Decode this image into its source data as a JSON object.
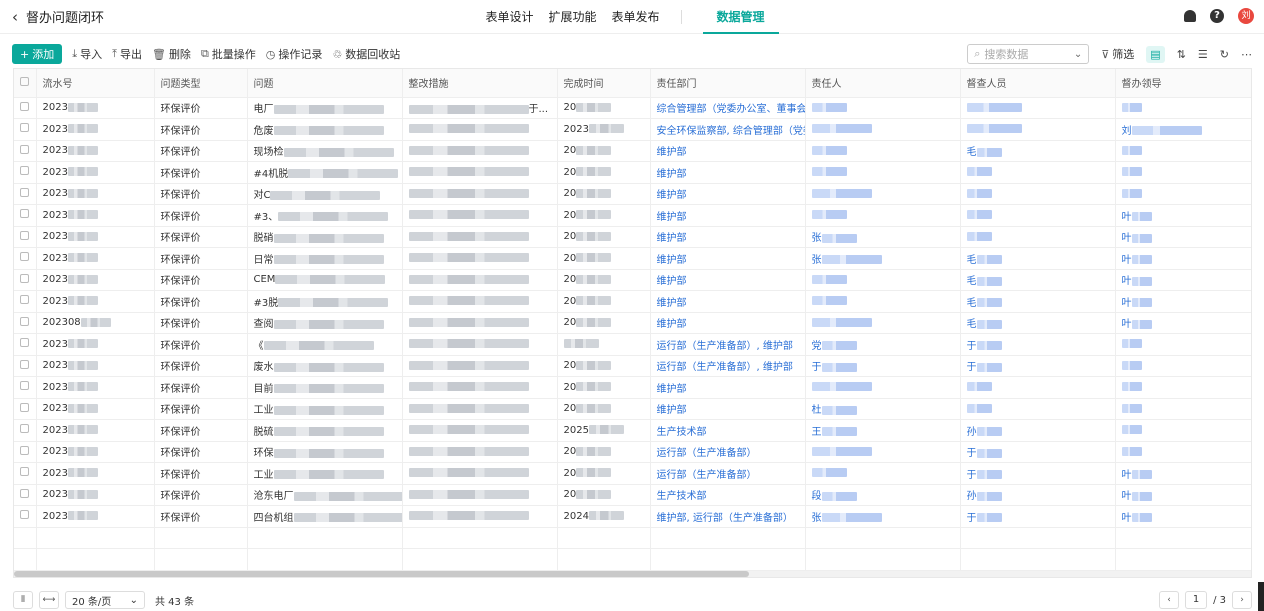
{
  "header": {
    "title": "督办问题闭环",
    "tabs": [
      "表单设计",
      "扩展功能",
      "表单发布",
      "数据管理"
    ],
    "active_tab": "数据管理",
    "help": "?",
    "avatar": "刘"
  },
  "toolbar": {
    "add": "添加",
    "import": "导入",
    "export": "导出",
    "delete": "删除",
    "batch": "批量操作",
    "log": "操作记录",
    "recycle": "数据回收站",
    "search_placeholder": "搜索数据",
    "filter": "筛选"
  },
  "columns": [
    "流水号",
    "问题类型",
    "问题",
    "整改措施",
    "完成时间",
    "责任部门",
    "责任人",
    "督查人员",
    "督办领导"
  ],
  "rows": [
    {
      "id": "2023",
      "type": "环保评价",
      "q": "电厂",
      "m": "于...",
      "t": "20",
      "dept": "综合管理部（党委办公室、董事会办...",
      "p": "",
      "s": "",
      "l": ""
    },
    {
      "id": "2023",
      "type": "环保评价",
      "q": "危废",
      "m": "",
      "t": "2023",
      "dept": "安全环保监察部, 综合管理部（党委办...",
      "p": "",
      "s": "",
      "l": "刘"
    },
    {
      "id": "2023",
      "type": "环保评价",
      "q": "现场检",
      "m": "",
      "t": "20",
      "dept": "维护部",
      "p": "",
      "s": "毛",
      "l": ""
    },
    {
      "id": "2023",
      "type": "环保评价",
      "q": "#4机脱",
      "m": "",
      "t": "20",
      "dept": "维护部",
      "p": "",
      "s": "",
      "l": ""
    },
    {
      "id": "2023",
      "type": "环保评价",
      "q": "对C",
      "m": "",
      "t": "20",
      "dept": "维护部",
      "p": "",
      "s": "",
      "l": ""
    },
    {
      "id": "2023",
      "type": "环保评价",
      "q": "#3、",
      "m": "",
      "t": "20",
      "dept": "维护部",
      "p": "",
      "s": "",
      "l": "叶"
    },
    {
      "id": "2023",
      "type": "环保评价",
      "q": "脱硝",
      "m": "",
      "t": "20",
      "dept": "维护部",
      "p": "张",
      "s": "",
      "l": "叶"
    },
    {
      "id": "2023",
      "type": "环保评价",
      "q": "日常",
      "m": "",
      "t": "20",
      "dept": "维护部",
      "p": "张",
      "s": "毛",
      "l": "叶"
    },
    {
      "id": "2023",
      "type": "环保评价",
      "q": "CEM",
      "m": "",
      "t": "20",
      "dept": "维护部",
      "p": "",
      "s": "毛",
      "l": "叶"
    },
    {
      "id": "2023",
      "type": "环保评价",
      "q": "#3脱",
      "m": "",
      "t": "20",
      "dept": "维护部",
      "p": "",
      "s": "毛",
      "l": "叶"
    },
    {
      "id": "202308",
      "type": "环保评价",
      "q": "查阅",
      "m": "",
      "t": "20",
      "dept": "维护部",
      "p": "",
      "s": "毛",
      "l": "叶"
    },
    {
      "id": "2023",
      "type": "环保评价",
      "q": "《",
      "m": "",
      "t": "",
      "dept": "运行部（生产准备部）, 维护部",
      "p": "党",
      "s": "于",
      "l": ""
    },
    {
      "id": "2023",
      "type": "环保评价",
      "q": "废水",
      "m": "",
      "t": "20",
      "dept": "运行部（生产准备部）, 维护部",
      "p": "于",
      "s": "于",
      "l": ""
    },
    {
      "id": "2023",
      "type": "环保评价",
      "q": "目前",
      "m": "",
      "t": "20",
      "dept": "维护部",
      "p": "",
      "s": "",
      "l": ""
    },
    {
      "id": "2023",
      "type": "环保评价",
      "q": "工业",
      "m": "",
      "t": "20",
      "dept": "维护部",
      "p": "杜",
      "s": "",
      "l": ""
    },
    {
      "id": "2023",
      "type": "环保评价",
      "q": "脱硫",
      "m": "",
      "t": "2025",
      "dept": "生产技术部",
      "p": "王",
      "s": "孙",
      "l": ""
    },
    {
      "id": "2023",
      "type": "环保评价",
      "q": "环保",
      "m": "",
      "t": "20",
      "dept": "运行部（生产准备部）",
      "p": "",
      "s": "于",
      "l": ""
    },
    {
      "id": "2023",
      "type": "环保评价",
      "q": "工业",
      "m": "",
      "t": "20",
      "dept": "运行部（生产准备部）",
      "p": "",
      "s": "于",
      "l": "叶"
    },
    {
      "id": "2023",
      "type": "环保评价",
      "q": "沧东电厂",
      "m": "",
      "t": "20",
      "dept": "生产技术部",
      "p": "段",
      "s": "孙",
      "l": "叶"
    },
    {
      "id": "2023",
      "type": "环保评价",
      "q": "四台机组",
      "m": "",
      "t": "2024",
      "dept": "维护部, 运行部（生产准备部）",
      "p": "张",
      "s": "于",
      "l": "叶"
    }
  ],
  "footer": {
    "page_size": "20 条/页",
    "total": "共 43 条",
    "page": "1",
    "pages": "/ 3"
  }
}
